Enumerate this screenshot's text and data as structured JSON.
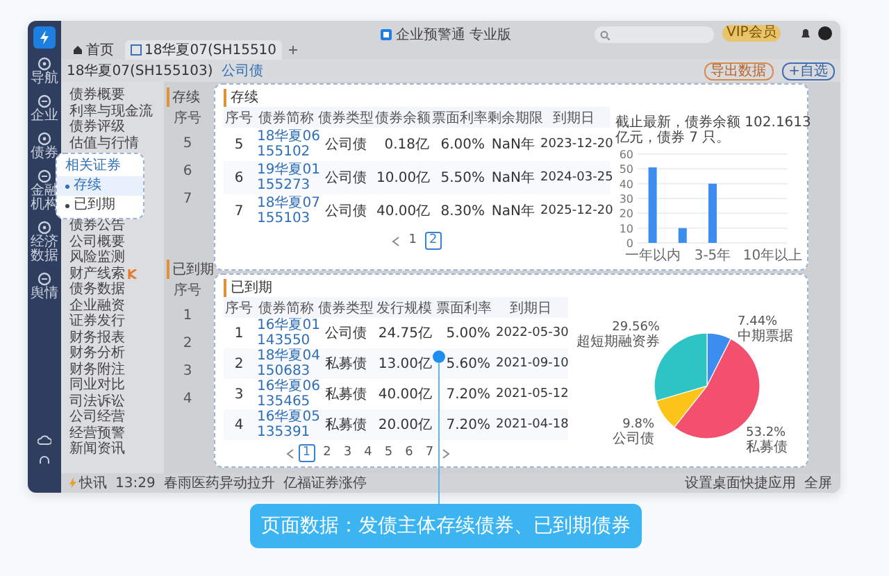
{
  "window": {
    "title": "企业预警通 专业版",
    "badge": "VIP会员"
  },
  "sidebar": {
    "items": [
      {
        "label": "导航"
      },
      {
        "label": "企业"
      },
      {
        "label": "债券"
      },
      {
        "label": "金融机构"
      },
      {
        "label": "经济数据"
      },
      {
        "label": "舆情"
      }
    ]
  },
  "tabs": [
    {
      "label": "首页",
      "selected": false
    },
    {
      "label": "18华夏07(SH15510",
      "selected": true
    }
  ],
  "header": {
    "title": "18华夏07(SH155103)",
    "tag": "公司债",
    "buttons": [
      "导出数据",
      "+自选"
    ]
  },
  "menu": {
    "upper": [
      {
        "label": "债券概要",
        "flagged": false
      },
      {
        "label": "利率与现金流",
        "flagged": false
      },
      {
        "label": "债券评级",
        "flagged": false
      },
      {
        "label": "估值与行情",
        "flagged": false
      }
    ],
    "lower": [
      {
        "label": "债券公告",
        "flagged": false
      },
      {
        "label": "公司概要",
        "flagged": false
      },
      {
        "label": "风险监测",
        "flagged": false
      },
      {
        "label": "财产线索",
        "flagged": true
      },
      {
        "label": "债务数据",
        "flagged": false
      },
      {
        "label": "企业融资",
        "flagged": false
      },
      {
        "label": "证券发行",
        "flagged": false
      },
      {
        "label": "财务报表",
        "flagged": false
      },
      {
        "label": "财务分析",
        "flagged": false
      },
      {
        "label": "财务附注",
        "flagged": false
      },
      {
        "label": "同业对比",
        "flagged": false
      },
      {
        "label": "司法诉讼",
        "flagged": false
      },
      {
        "label": "公司经营",
        "flagged": false
      },
      {
        "label": "经营预警",
        "flagged": false
      },
      {
        "label": "新闻资讯",
        "flagged": false
      }
    ]
  },
  "popup": {
    "title": "相关证券",
    "items": [
      {
        "label": "存续",
        "selected": true
      },
      {
        "label": "已到期",
        "selected": false
      }
    ]
  },
  "back_panel": {
    "sections": [
      {
        "title": "存续",
        "column": "序号",
        "rows": [
          "5",
          "6",
          "7"
        ]
      },
      {
        "title": "已到期",
        "column": "序号",
        "rows": [
          "1",
          "2",
          "3",
          "4"
        ]
      }
    ]
  },
  "outstanding": {
    "title": "存续",
    "columns": [
      "序号",
      "债券简称",
      "债券类型",
      "债券余额",
      "票面利率",
      "剩余期限",
      "到期日"
    ],
    "rows": [
      [
        "5",
        "18华夏06\n155102",
        "公司债",
        "0.18亿",
        "6.00%",
        "NaN年",
        "2023-12-20"
      ],
      [
        "6",
        "19华夏01\n155273",
        "公司债",
        "10.00亿",
        "5.50%",
        "NaN年",
        "2024-03-25"
      ],
      [
        "7",
        "18华夏07\n155103",
        "公司债",
        "40.00亿",
        "8.30%",
        "NaN年",
        "2025-12-20"
      ]
    ],
    "pages": [
      {
        "label": "1",
        "selected": false
      },
      {
        "label": "2",
        "selected": true
      }
    ],
    "chart_data": {
      "type": "bar",
      "title": "截止最新，债券余额 102.1613 亿元，债券 7 只。",
      "categories": [
        "一年以内",
        null,
        "3-5年",
        null,
        "10年以上"
      ],
      "values": [
        51,
        10,
        40,
        null,
        null
      ],
      "ylim": [
        0,
        60
      ],
      "grid": true,
      "yticks": [
        0,
        10,
        20,
        30,
        40,
        50,
        60
      ]
    }
  },
  "matured": {
    "title": "已到期",
    "columns": [
      "序号",
      "债券简称",
      "债券类型",
      "发行规模",
      "票面利率",
      "到期日"
    ],
    "rows": [
      [
        "1",
        "16华夏01\n143550",
        "公司债",
        "24.75亿",
        "5.00%",
        "2022-05-30"
      ],
      [
        "2",
        "18华夏04\n150683",
        "私募债",
        "13.00亿",
        "5.60%",
        "2021-09-10"
      ],
      [
        "3",
        "16华夏06\n135465",
        "私募债",
        "40.00亿",
        "7.20%",
        "2021-05-12"
      ],
      [
        "4",
        "16华夏05\n135391",
        "私募债",
        "20.00亿",
        "7.20%",
        "2021-04-18"
      ]
    ],
    "pages": [
      {
        "label": "1",
        "selected": true
      },
      {
        "label": "2",
        "selected": false
      },
      {
        "label": "3",
        "selected": false
      },
      {
        "label": "4",
        "selected": false
      },
      {
        "label": "5",
        "selected": false
      },
      {
        "label": "6",
        "selected": false
      },
      {
        "label": "7",
        "selected": false
      }
    ],
    "chart_data": {
      "type": "pie",
      "categories": [
        "中期票据",
        "私募债",
        "公司债",
        "超短期融资券"
      ],
      "values": [
        7.44,
        53.2,
        9.8,
        29.56
      ],
      "value_labels": [
        "7.44%",
        "53.2%",
        "9.8%",
        "29.56%"
      ]
    }
  },
  "status_bar": {
    "label": "快讯",
    "time": "13:29",
    "news": [
      "春雨医药异动拉升",
      "亿福证券涨停"
    ],
    "right": [
      "设置桌面快捷应用",
      "全屏"
    ]
  },
  "callout": "页面数据：发债主体存续债券、已到期债券"
}
